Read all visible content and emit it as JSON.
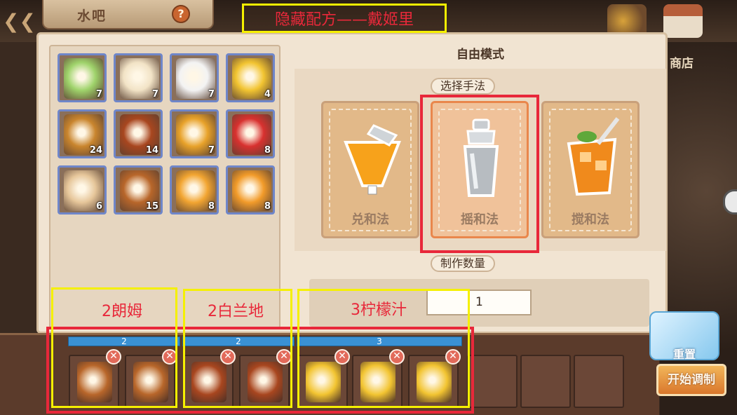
{
  "header": {
    "back_icon": "back-arrow-icon",
    "title": "水吧",
    "help_symbol": "?",
    "annotation": "隐藏配方——戴姬里"
  },
  "topbar": {
    "fruit_icon": "fruit-basket-icon",
    "shop_icon": "shop-stall-icon",
    "shop_label": "商店"
  },
  "inventory": {
    "items": [
      {
        "icon": "soda-bottle-icon",
        "count": "7",
        "color": "#9fd36b"
      },
      {
        "icon": "cream-cupcake-icon",
        "count": "7",
        "color": "#f2e3c6"
      },
      {
        "icon": "sugar-pile-icon",
        "count": "7",
        "color": "#f3f3f3"
      },
      {
        "icon": "lemon-juice-icon",
        "count": "4",
        "color": "#f2c431"
      },
      {
        "icon": "rum-bottle-cocktail-icon",
        "count": "24",
        "color": "#c9852e"
      },
      {
        "icon": "brandy-bottle-icon",
        "count": "14",
        "color": "#a8461f"
      },
      {
        "icon": "honey-jar-icon",
        "count": "7",
        "color": "#e8a22a"
      },
      {
        "icon": "cola-can-icon",
        "count": "8",
        "color": "#d8312f"
      },
      {
        "icon": "martini-glass-icon",
        "count": "6",
        "color": "#e6c69a"
      },
      {
        "icon": "iced-rum-glass-icon",
        "count": "15",
        "color": "#b8662a"
      },
      {
        "icon": "orange-juice-bottle-icon",
        "count": "8",
        "color": "#f2a531"
      },
      {
        "icon": "orange-cocktail-icon",
        "count": "8",
        "color": "#f29b2a"
      }
    ]
  },
  "mixing": {
    "mode_title": "自由模式",
    "method_label": "选择手法",
    "methods": [
      {
        "label": "兑和法",
        "icon": "orange-glass-jigger-icon",
        "selected": false
      },
      {
        "label": "摇和法",
        "icon": "cocktail-shaker-icon",
        "selected": true
      },
      {
        "label": "搅和法",
        "icon": "iced-tea-glass-icon",
        "selected": false
      }
    ],
    "quantity_label": "制作数量",
    "quantity_value": "1"
  },
  "annotations": {
    "rum": "2朗姆",
    "brandy": "2白兰地",
    "lemon": "3柠檬汁"
  },
  "recipe_bar": {
    "groups": [
      {
        "count": "2"
      },
      {
        "count": "2"
      },
      {
        "count": "3"
      }
    ],
    "slots": [
      {
        "icon": "iced-rum-glass-icon",
        "color": "#b8662a"
      },
      {
        "icon": "iced-rum-glass-icon",
        "color": "#b8662a"
      },
      {
        "icon": "brandy-bottle-icon",
        "color": "#a8461f"
      },
      {
        "icon": "brandy-bottle-icon",
        "color": "#a8461f"
      },
      {
        "icon": "lemon-juice-icon",
        "color": "#f2c431"
      },
      {
        "icon": "lemon-juice-icon",
        "color": "#f2c431"
      },
      {
        "icon": "lemon-juice-icon",
        "color": "#f2c431"
      }
    ],
    "remove_symbol": "✕"
  },
  "actions": {
    "reset_label": "重置",
    "reset_icon": "ice-cubes-icon",
    "start_label": "开始调制"
  },
  "colors": {
    "highlight_red": "#e8283a",
    "highlight_yellow": "#f5f000",
    "bar_blue": "#3a91d4"
  }
}
